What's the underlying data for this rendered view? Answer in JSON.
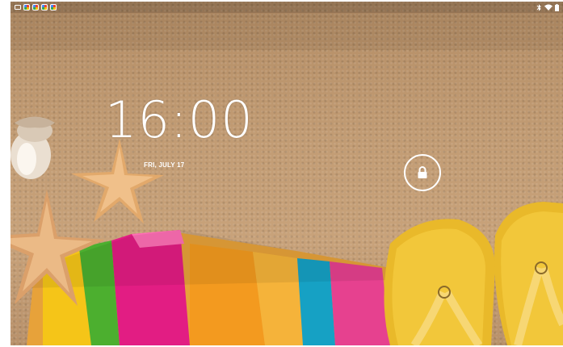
{
  "lockscreen": {
    "time": "16:00",
    "date": "FRI, JULY 17"
  },
  "status_bar": {
    "notification_icons": [
      "screenshot-icon",
      "app-icon",
      "app-icon",
      "app-icon",
      "app-icon"
    ],
    "system_icons": [
      "bluetooth-icon",
      "wifi-icon",
      "battery-icon"
    ]
  },
  "colors": {
    "sand": "#c29c74",
    "text": "#ffffff",
    "flip_flop": "#e9b92a",
    "towel": [
      "#e3218c",
      "#f39200",
      "#6cbf2b",
      "#f6d114",
      "#1aa3c9"
    ]
  },
  "wallpaper": {
    "elements": [
      "seashell",
      "starfish",
      "starfish",
      "striped-towel",
      "flip-flop",
      "flip-flop"
    ]
  }
}
